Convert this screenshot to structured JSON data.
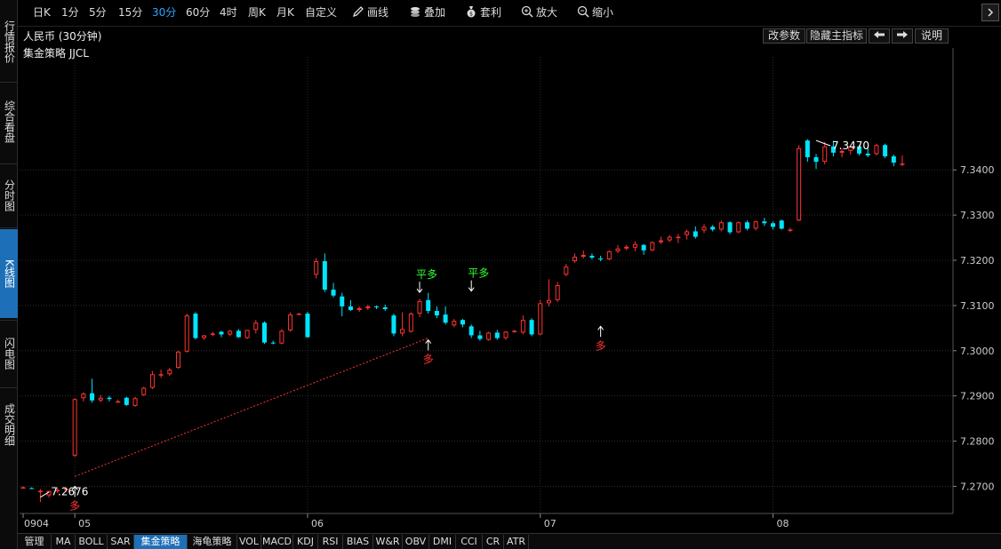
{
  "left_nav": [
    {
      "label": "行情报价",
      "active": false
    },
    {
      "label": "综合看盘",
      "active": false
    },
    {
      "label": "分时图",
      "active": false
    },
    {
      "label": "K线图",
      "active": true
    },
    {
      "label": "闪电图",
      "active": false
    },
    {
      "label": "成交明细",
      "active": false
    }
  ],
  "toolbar": {
    "periods": [
      "日K",
      "1分",
      "5分",
      "15分",
      "30分",
      "60分",
      "4时",
      "周K",
      "月K",
      "自定义"
    ],
    "active_period": "30分",
    "draw_label": "画线",
    "overlay_label": "叠加",
    "arbitrage_label": "套利",
    "zoom_in_label": "放大",
    "zoom_out_label": "缩小"
  },
  "info_bar": {
    "title": "人民币 (30分钟)",
    "edit_params_label": "改参数",
    "hide_indicator_label": "隐藏主指标",
    "help_label": "说明"
  },
  "strategy_label": "集金策略 JJCL",
  "bottom_tabs": [
    "管理",
    "MA",
    "BOLL",
    "SAR",
    "集金策略",
    "海龟策略",
    "VOL",
    "MACD",
    "KDJ",
    "RSI",
    "BIAS",
    "W&R",
    "OBV",
    "DMI",
    "CCI",
    "CR",
    "ATR"
  ],
  "active_bottom_tab": "集金策略",
  "colors": {
    "up": "#ff3333",
    "down": "#00e5ff",
    "grid": "#2a2a2a",
    "axis_text": "#cccccc",
    "signal_up": "#ff3333",
    "signal_close": "#33ff33"
  },
  "chart_data": {
    "type": "candlestick",
    "ylim": [
      7.264,
      7.365
    ],
    "y_ticks": [
      7.27,
      7.28,
      7.29,
      7.3,
      7.31,
      7.32,
      7.33,
      7.34
    ],
    "y_tick_labels": [
      "7.2700",
      "7.2800",
      "7.2900",
      "7.3000",
      "7.3100",
      "7.3200",
      "7.3300",
      "7.3400"
    ],
    "x_labels": [
      {
        "label": "0904",
        "index": 0
      },
      {
        "label": "05",
        "index": 6
      },
      {
        "label": "06",
        "index": 33
      },
      {
        "label": "07",
        "index": 60
      },
      {
        "label": "08",
        "index": 87
      }
    ],
    "candles": [
      [
        7.2698,
        7.27,
        7.2696,
        7.2698
      ],
      [
        7.2696,
        7.2698,
        7.2694,
        7.2694
      ],
      [
        7.2687,
        7.2694,
        7.2665,
        7.269
      ],
      [
        7.268,
        7.269,
        7.2675,
        7.269
      ],
      [
        7.269,
        7.2698,
        7.2685,
        7.2692
      ],
      [
        7.2692,
        7.2698,
        7.2688,
        7.2695
      ],
      [
        7.2768,
        7.2895,
        7.2765,
        7.2893
      ],
      [
        7.2895,
        7.2908,
        7.2888,
        7.2905
      ],
      [
        7.2906,
        7.2938,
        7.2885,
        7.289
      ],
      [
        7.289,
        7.2902,
        7.2886,
        7.2896
      ],
      [
        7.2896,
        7.29,
        7.2888,
        7.2893
      ],
      [
        7.2888,
        7.2892,
        7.2886,
        7.2888
      ],
      [
        7.2896,
        7.2898,
        7.2878,
        7.288
      ],
      [
        7.2878,
        7.2898,
        7.2876,
        7.2895
      ],
      [
        7.2902,
        7.292,
        7.29,
        7.2918
      ],
      [
        7.2918,
        7.2955,
        7.2915,
        7.2948
      ],
      [
        7.2945,
        7.2958,
        7.294,
        7.2948
      ],
      [
        7.2948,
        7.2962,
        7.2944,
        7.2958
      ],
      [
        7.2962,
        7.3,
        7.296,
        7.2998
      ],
      [
        7.2998,
        7.3082,
        7.2996,
        7.3078
      ],
      [
        7.3082,
        7.3085,
        7.3025,
        7.3028
      ],
      [
        7.3028,
        7.3035,
        7.3024,
        7.3034
      ],
      [
        7.3036,
        7.3042,
        7.3032,
        7.3038
      ],
      [
        7.3042,
        7.3044,
        7.303,
        7.3036
      ],
      [
        7.3036,
        7.3046,
        7.3032,
        7.3044
      ],
      [
        7.3044,
        7.3048,
        7.3028,
        7.303
      ],
      [
        7.3028,
        7.3046,
        7.3026,
        7.3046
      ],
      [
        7.3046,
        7.3068,
        7.3038,
        7.3062
      ],
      [
        7.3062,
        7.3065,
        7.3015,
        7.3018
      ],
      [
        7.3018,
        7.3022,
        7.3014,
        7.3016
      ],
      [
        7.3016,
        7.3048,
        7.3014,
        7.3044
      ],
      [
        7.3045,
        7.3085,
        7.3042,
        7.308
      ],
      [
        7.3082,
        7.3084,
        7.308,
        7.3082
      ],
      [
        7.3082,
        7.3086,
        7.3028,
        7.303
      ],
      [
        7.3168,
        7.3205,
        7.316,
        7.3198
      ],
      [
        7.3198,
        7.3215,
        7.313,
        7.3135
      ],
      [
        7.3135,
        7.315,
        7.3118,
        7.3122
      ],
      [
        7.312,
        7.3128,
        7.3076,
        7.3098
      ],
      [
        7.3098,
        7.3112,
        7.3088,
        7.309
      ],
      [
        7.309,
        7.3098,
        7.3086,
        7.3094
      ],
      [
        7.3094,
        7.3102,
        7.309,
        7.3098
      ],
      [
        7.3098,
        7.31,
        7.3092,
        7.3096
      ],
      [
        7.3096,
        7.3102,
        7.3088,
        7.3092
      ],
      [
        7.3078,
        7.3082,
        7.3032,
        7.3038
      ],
      [
        7.3038,
        7.3085,
        7.3032,
        7.3048
      ],
      [
        7.3042,
        7.3085,
        7.304,
        7.3082
      ],
      [
        7.3082,
        7.3115,
        7.3074,
        7.311
      ],
      [
        7.3112,
        7.3128,
        7.3082,
        7.3088
      ],
      [
        7.3088,
        7.3098,
        7.3072,
        7.3078
      ],
      [
        7.308,
        7.3098,
        7.3058,
        7.3062
      ],
      [
        7.3056,
        7.307,
        7.3052,
        7.3066
      ],
      [
        7.3068,
        7.307,
        7.3052,
        7.3058
      ],
      [
        7.3054,
        7.3058,
        7.3028,
        7.3034
      ],
      [
        7.3034,
        7.3044,
        7.3022,
        7.3026
      ],
      [
        7.3024,
        7.3042,
        7.3022,
        7.304
      ],
      [
        7.304,
        7.3046,
        7.3024,
        7.3028
      ],
      [
        7.3028,
        7.3044,
        7.3024,
        7.3042
      ],
      [
        7.3042,
        7.3046,
        7.304,
        7.3044
      ],
      [
        7.304,
        7.3078,
        7.3036,
        7.3068
      ],
      [
        7.3068,
        7.3072,
        7.3032,
        7.3036
      ],
      [
        7.3036,
        7.3112,
        7.3034,
        7.3105
      ],
      [
        7.3105,
        7.3158,
        7.3098,
        7.3112
      ],
      [
        7.3112,
        7.3152,
        7.3108,
        7.3145
      ],
      [
        7.3168,
        7.3192,
        7.3165,
        7.3186
      ],
      [
        7.3198,
        7.3215,
        7.3194,
        7.3208
      ],
      [
        7.3208,
        7.3222,
        7.3204,
        7.3212
      ],
      [
        7.321,
        7.3215,
        7.3202,
        7.3206
      ],
      [
        7.3204,
        7.321,
        7.3198,
        7.3202
      ],
      [
        7.3202,
        7.3222,
        7.32,
        7.322
      ],
      [
        7.322,
        7.3234,
        7.3216,
        7.3226
      ],
      [
        7.3226,
        7.3234,
        7.3222,
        7.323
      ],
      [
        7.3228,
        7.3242,
        7.322,
        7.3236
      ],
      [
        7.3234,
        7.3236,
        7.3212,
        7.3222
      ],
      [
        7.3222,
        7.3242,
        7.322,
        7.324
      ],
      [
        7.324,
        7.3252,
        7.3236,
        7.3244
      ],
      [
        7.3244,
        7.3256,
        7.324,
        7.3252
      ],
      [
        7.3252,
        7.3258,
        7.3238,
        7.3252
      ],
      [
        7.3256,
        7.3268,
        7.3246,
        7.3264
      ],
      [
        7.3264,
        7.3275,
        7.3248,
        7.3252
      ],
      [
        7.3266,
        7.328,
        7.326,
        7.3274
      ],
      [
        7.3274,
        7.3278,
        7.3264,
        7.3268
      ],
      [
        7.3268,
        7.3288,
        7.3264,
        7.3284
      ],
      [
        7.3284,
        7.3286,
        7.3258,
        7.3262
      ],
      [
        7.3262,
        7.3286,
        7.326,
        7.3284
      ],
      [
        7.3284,
        7.3288,
        7.3266,
        7.327
      ],
      [
        7.327,
        7.3288,
        7.3266,
        7.3286
      ],
      [
        7.3286,
        7.3294,
        7.3276,
        7.3282
      ],
      [
        7.3282,
        7.3286,
        7.3268,
        7.3274
      ],
      [
        7.3288,
        7.329,
        7.3268,
        7.327
      ],
      [
        7.3268,
        7.3272,
        7.3262,
        7.3268
      ],
      [
        7.3288,
        7.3455,
        7.3286,
        7.3448
      ],
      [
        7.3465,
        7.3468,
        7.3418,
        7.3428
      ],
      [
        7.3428,
        7.3435,
        7.3402,
        7.3418
      ],
      [
        7.3418,
        7.3462,
        7.3412,
        7.3452
      ],
      [
        7.3452,
        7.3464,
        7.343,
        7.3438
      ],
      [
        7.3438,
        7.3446,
        7.3428,
        7.3442
      ],
      [
        7.3442,
        7.3454,
        7.3434,
        7.3452
      ],
      [
        7.3452,
        7.3455,
        7.3432,
        7.3436
      ],
      [
        7.3436,
        7.3452,
        7.3428,
        7.3432
      ],
      [
        7.3435,
        7.3458,
        7.3432,
        7.3455
      ],
      [
        7.3455,
        7.3458,
        7.3426,
        7.343
      ],
      [
        7.343,
        7.3434,
        7.3408,
        7.3416
      ],
      [
        7.3412,
        7.3432,
        7.3408,
        7.3414
      ]
    ],
    "annotations": [
      {
        "type": "low-label",
        "text": "7.2676",
        "index": 2,
        "price": 7.2676
      },
      {
        "type": "high-label",
        "text": "7.3470",
        "index": 92,
        "price": 7.3465
      },
      {
        "type": "buy-signal",
        "text": "多",
        "index": 6,
        "price": 7.2704
      },
      {
        "type": "buy-signal",
        "text": "多",
        "index": 47,
        "price": 7.3028
      },
      {
        "type": "buy-signal",
        "text": "多",
        "index": 67,
        "price": 7.3058
      },
      {
        "type": "close-signal",
        "text": "平多",
        "index": 46,
        "price": 7.3125
      },
      {
        "type": "close-signal",
        "text": "平多",
        "index": 52,
        "price": 7.3128
      }
    ],
    "trend_line": {
      "from": {
        "index": 6,
        "price": 7.2722
      },
      "to": {
        "index": 47,
        "price": 7.3028
      }
    }
  }
}
